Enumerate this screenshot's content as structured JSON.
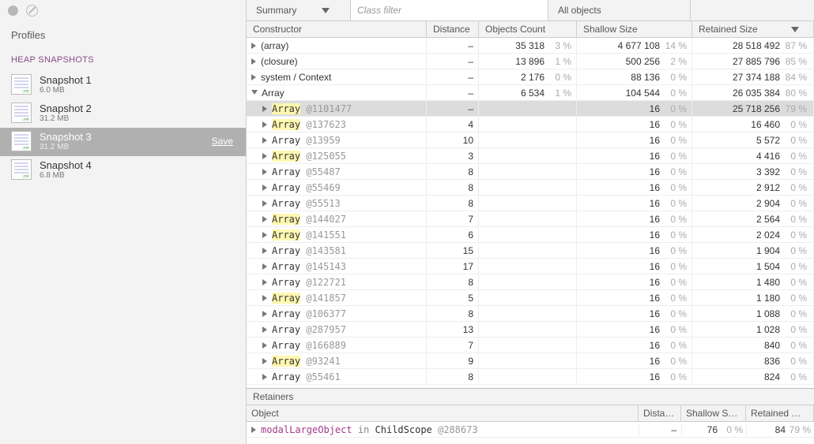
{
  "sidebar": {
    "title": "Profiles",
    "section": "HEAP SNAPSHOTS",
    "save_label": "Save",
    "snapshots": [
      {
        "name": "Snapshot 1",
        "size": "6.0 MB",
        "selected": false
      },
      {
        "name": "Snapshot 2",
        "size": "31.2 MB",
        "selected": false
      },
      {
        "name": "Snapshot 3",
        "size": "31.2 MB",
        "selected": true
      },
      {
        "name": "Snapshot 4",
        "size": "6.8 MB",
        "selected": false
      }
    ]
  },
  "toolbar": {
    "view": "Summary",
    "filter_placeholder": "Class filter",
    "scope": "All objects"
  },
  "columns": {
    "constructor": "Constructor",
    "distance": "Distance",
    "objects_count": "Objects Count",
    "shallow": "Shallow Size",
    "retained": "Retained Size"
  },
  "rows": [
    {
      "depth": 0,
      "expand": "closed",
      "label": "(array)",
      "hl": false,
      "addr": "",
      "distance": "–",
      "count": "35 318",
      "count_pct": "3 %",
      "shallow": "4 677 108",
      "shallow_pct": "14 %",
      "retained": "28 518 492",
      "retained_pct": "87 %",
      "highlighted": false
    },
    {
      "depth": 0,
      "expand": "closed",
      "label": "(closure)",
      "hl": false,
      "addr": "",
      "distance": "–",
      "count": "13 896",
      "count_pct": "1 %",
      "shallow": "500 256",
      "shallow_pct": "2 %",
      "retained": "27 885 796",
      "retained_pct": "85 %",
      "highlighted": false
    },
    {
      "depth": 0,
      "expand": "closed",
      "label": "system / Context",
      "hl": false,
      "addr": "",
      "distance": "–",
      "count": "2 176",
      "count_pct": "0 %",
      "shallow": "88 136",
      "shallow_pct": "0 %",
      "retained": "27 374 188",
      "retained_pct": "84 %",
      "highlighted": false
    },
    {
      "depth": 0,
      "expand": "open",
      "label": "Array",
      "hl": false,
      "addr": "",
      "distance": "–",
      "count": "6 534",
      "count_pct": "1 %",
      "shallow": "104 544",
      "shallow_pct": "0 %",
      "retained": "26 035 384",
      "retained_pct": "80 %",
      "highlighted": false
    },
    {
      "depth": 1,
      "expand": "closed",
      "label": "Array",
      "hl": true,
      "addr": "@1101477",
      "distance": "–",
      "count": "",
      "count_pct": "",
      "shallow": "16",
      "shallow_pct": "0 %",
      "retained": "25 718 256",
      "retained_pct": "79 %",
      "highlighted": true
    },
    {
      "depth": 1,
      "expand": "closed",
      "label": "Array",
      "hl": true,
      "addr": "@137623",
      "distance": "4",
      "count": "",
      "count_pct": "",
      "shallow": "16",
      "shallow_pct": "0 %",
      "retained": "16 460",
      "retained_pct": "0 %",
      "highlighted": false
    },
    {
      "depth": 1,
      "expand": "closed",
      "label": "Array",
      "hl": false,
      "addr": "@13959",
      "distance": "10",
      "count": "",
      "count_pct": "",
      "shallow": "16",
      "shallow_pct": "0 %",
      "retained": "5 572",
      "retained_pct": "0 %",
      "highlighted": false
    },
    {
      "depth": 1,
      "expand": "closed",
      "label": "Array",
      "hl": true,
      "addr": "@125055",
      "distance": "3",
      "count": "",
      "count_pct": "",
      "shallow": "16",
      "shallow_pct": "0 %",
      "retained": "4 416",
      "retained_pct": "0 %",
      "highlighted": false
    },
    {
      "depth": 1,
      "expand": "closed",
      "label": "Array",
      "hl": false,
      "addr": "@55487",
      "distance": "8",
      "count": "",
      "count_pct": "",
      "shallow": "16",
      "shallow_pct": "0 %",
      "retained": "3 392",
      "retained_pct": "0 %",
      "highlighted": false
    },
    {
      "depth": 1,
      "expand": "closed",
      "label": "Array",
      "hl": false,
      "addr": "@55469",
      "distance": "8",
      "count": "",
      "count_pct": "",
      "shallow": "16",
      "shallow_pct": "0 %",
      "retained": "2 912",
      "retained_pct": "0 %",
      "highlighted": false
    },
    {
      "depth": 1,
      "expand": "closed",
      "label": "Array",
      "hl": false,
      "addr": "@55513",
      "distance": "8",
      "count": "",
      "count_pct": "",
      "shallow": "16",
      "shallow_pct": "0 %",
      "retained": "2 904",
      "retained_pct": "0 %",
      "highlighted": false
    },
    {
      "depth": 1,
      "expand": "closed",
      "label": "Array",
      "hl": true,
      "addr": "@144027",
      "distance": "7",
      "count": "",
      "count_pct": "",
      "shallow": "16",
      "shallow_pct": "0 %",
      "retained": "2 564",
      "retained_pct": "0 %",
      "highlighted": false
    },
    {
      "depth": 1,
      "expand": "closed",
      "label": "Array",
      "hl": true,
      "addr": "@141551",
      "distance": "6",
      "count": "",
      "count_pct": "",
      "shallow": "16",
      "shallow_pct": "0 %",
      "retained": "2 024",
      "retained_pct": "0 %",
      "highlighted": false
    },
    {
      "depth": 1,
      "expand": "closed",
      "label": "Array",
      "hl": false,
      "addr": "@143581",
      "distance": "15",
      "count": "",
      "count_pct": "",
      "shallow": "16",
      "shallow_pct": "0 %",
      "retained": "1 904",
      "retained_pct": "0 %",
      "highlighted": false
    },
    {
      "depth": 1,
      "expand": "closed",
      "label": "Array",
      "hl": false,
      "addr": "@145143",
      "distance": "17",
      "count": "",
      "count_pct": "",
      "shallow": "16",
      "shallow_pct": "0 %",
      "retained": "1 504",
      "retained_pct": "0 %",
      "highlighted": false
    },
    {
      "depth": 1,
      "expand": "closed",
      "label": "Array",
      "hl": false,
      "addr": "@122721",
      "distance": "8",
      "count": "",
      "count_pct": "",
      "shallow": "16",
      "shallow_pct": "0 %",
      "retained": "1 480",
      "retained_pct": "0 %",
      "highlighted": false
    },
    {
      "depth": 1,
      "expand": "closed",
      "label": "Array",
      "hl": true,
      "addr": "@141857",
      "distance": "5",
      "count": "",
      "count_pct": "",
      "shallow": "16",
      "shallow_pct": "0 %",
      "retained": "1 180",
      "retained_pct": "0 %",
      "highlighted": false
    },
    {
      "depth": 1,
      "expand": "closed",
      "label": "Array",
      "hl": false,
      "addr": "@106377",
      "distance": "8",
      "count": "",
      "count_pct": "",
      "shallow": "16",
      "shallow_pct": "0 %",
      "retained": "1 088",
      "retained_pct": "0 %",
      "highlighted": false
    },
    {
      "depth": 1,
      "expand": "closed",
      "label": "Array",
      "hl": false,
      "addr": "@287957",
      "distance": "13",
      "count": "",
      "count_pct": "",
      "shallow": "16",
      "shallow_pct": "0 %",
      "retained": "1 028",
      "retained_pct": "0 %",
      "highlighted": false
    },
    {
      "depth": 1,
      "expand": "closed",
      "label": "Array",
      "hl": false,
      "addr": "@166889",
      "distance": "7",
      "count": "",
      "count_pct": "",
      "shallow": "16",
      "shallow_pct": "0 %",
      "retained": "840",
      "retained_pct": "0 %",
      "highlighted": false
    },
    {
      "depth": 1,
      "expand": "closed",
      "label": "Array",
      "hl": true,
      "addr": "@93241",
      "distance": "9",
      "count": "",
      "count_pct": "",
      "shallow": "16",
      "shallow_pct": "0 %",
      "retained": "836",
      "retained_pct": "0 %",
      "highlighted": false
    },
    {
      "depth": 1,
      "expand": "closed",
      "label": "Array",
      "hl": false,
      "addr": "@55461",
      "distance": "8",
      "count": "",
      "count_pct": "",
      "shallow": "16",
      "shallow_pct": "0 %",
      "retained": "824",
      "retained_pct": "0 %",
      "highlighted": false
    }
  ],
  "retainers": {
    "title": "Retainers",
    "cols": {
      "object": "Object",
      "distance": "Dista…",
      "shallow": "Shallow S…",
      "retained": "Retained …"
    },
    "row": {
      "prop": "modalLargeObject",
      "in": "in",
      "class": "ChildScope",
      "addr": "@288673",
      "distance": "–",
      "shallow": "76",
      "shallow_pct": "0 %",
      "retained": "84",
      "retained_pct": "79 %"
    }
  }
}
